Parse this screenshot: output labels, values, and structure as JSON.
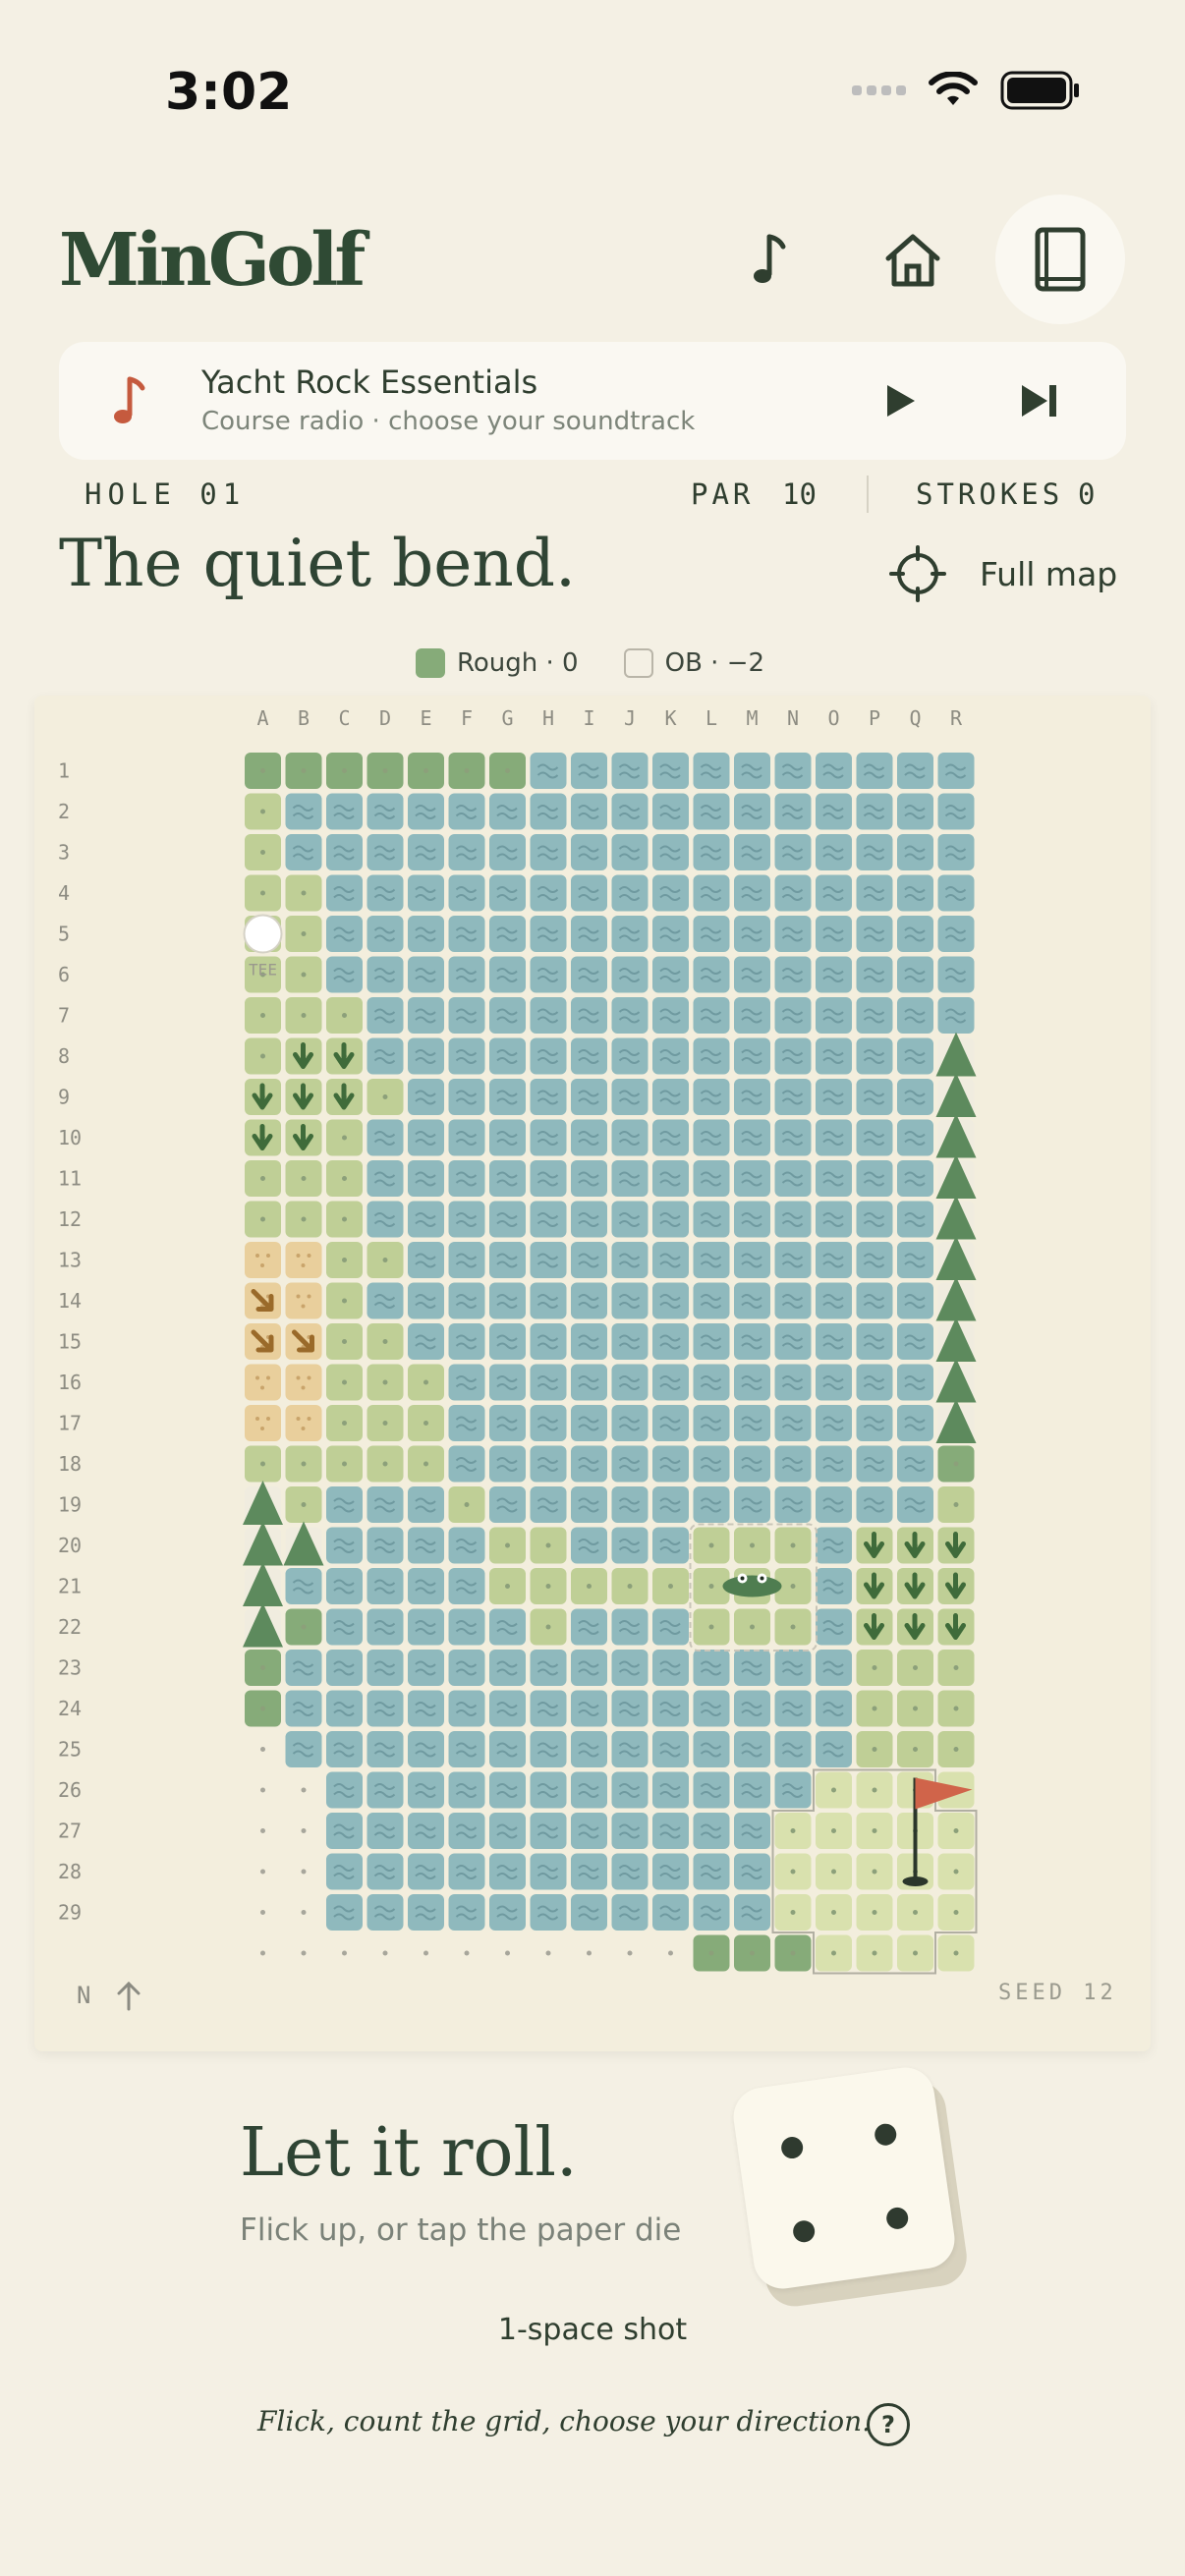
{
  "status": {
    "time": "3:02"
  },
  "header": {
    "title": "MinGolf",
    "music_icon": "music-note-icon",
    "home_icon": "home-icon",
    "book_icon": "book-icon"
  },
  "radio": {
    "title": "Yacht Rock Essentials",
    "subtitle": "Course radio · choose your soundtrack",
    "icon": "music-note-icon",
    "play_icon": "play-icon",
    "skip_icon": "skip-next-icon"
  },
  "hole": {
    "label": "HOLE 01",
    "par_label": "PAR",
    "par_value": "10",
    "strokes_label": "STROKES",
    "strokes_value": "0",
    "name": "The quiet bend.",
    "full_map_label": "Full map"
  },
  "legend": [
    {
      "label": "Rough · 0",
      "color": "#86ab79"
    },
    {
      "label": "OB · −2",
      "color": "#f4f0e4"
    }
  ],
  "map": {
    "columns": [
      "A",
      "B",
      "C",
      "D",
      "E",
      "F",
      "G",
      "H",
      "I",
      "J",
      "K",
      "L",
      "M",
      "N",
      "O",
      "P",
      "Q",
      "R"
    ],
    "rows": [
      "1",
      "2",
      "3",
      "4",
      "5",
      "6",
      "7",
      "8",
      "9",
      "10",
      "11",
      "12",
      "13",
      "14",
      "15",
      "16",
      "17",
      "18",
      "19",
      "20",
      "21",
      "22",
      "23",
      "24",
      "25",
      "26",
      "27",
      "28",
      "29"
    ],
    "tee_label": "TEE",
    "compass_label": "N",
    "seed_label": "SEED 12",
    "colors": {
      "water": "#8fb9bd",
      "rough": "#86ab79",
      "fairway": "#bfcf96",
      "green": "#d9e1ae",
      "sand": "#e9cf9c",
      "tree": "#5d8a5d",
      "flag": "#d0644a"
    }
  },
  "roll": {
    "title": "Let it roll.",
    "subtitle": "Flick up, or tap the paper die",
    "die_value": 4,
    "shot_label": "1-space shot",
    "hint": "Flick, count the grid, choose your direction.",
    "help_label": "?"
  }
}
